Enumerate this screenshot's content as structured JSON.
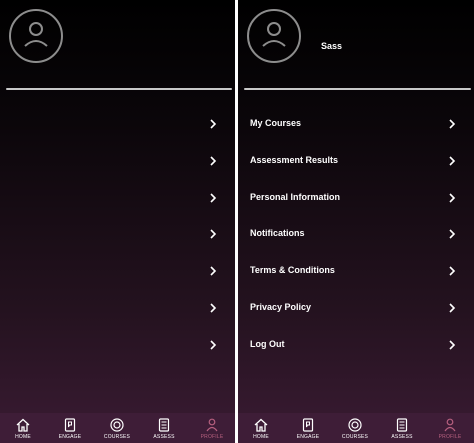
{
  "left_screen": {
    "menu_rows": 7,
    "tabs": [
      {
        "label": "HOME",
        "icon": "home-icon"
      },
      {
        "label": "ENGAGE",
        "icon": "engage-icon"
      },
      {
        "label": "COURSES",
        "icon": "courses-icon"
      },
      {
        "label": "ASSESS",
        "icon": "assess-icon"
      },
      {
        "label": "PROFILE",
        "icon": "profile-icon",
        "active": true
      }
    ]
  },
  "right_screen": {
    "username": "Sass",
    "menu": [
      {
        "label": "My Courses"
      },
      {
        "label": "Assessment Results"
      },
      {
        "label": "Personal Information"
      },
      {
        "label": "Notifications"
      },
      {
        "label": "Terms & Conditions"
      },
      {
        "label": "Privacy Policy"
      },
      {
        "label": "Log Out"
      }
    ],
    "tabs": [
      {
        "label": "HOME",
        "icon": "home-icon"
      },
      {
        "label": "ENGAGE",
        "icon": "engage-icon"
      },
      {
        "label": "COURSES",
        "icon": "courses-icon"
      },
      {
        "label": "ASSESS",
        "icon": "assess-icon"
      },
      {
        "label": "PROFILE",
        "icon": "profile-icon",
        "active": true
      }
    ]
  },
  "colors": {
    "background_top": "#000000",
    "background_bottom": "#3a1b33",
    "tabbar": "#3e1d37",
    "active_tab": "#b6607f",
    "text": "#ffffff",
    "divider": "#c9c9c9"
  }
}
